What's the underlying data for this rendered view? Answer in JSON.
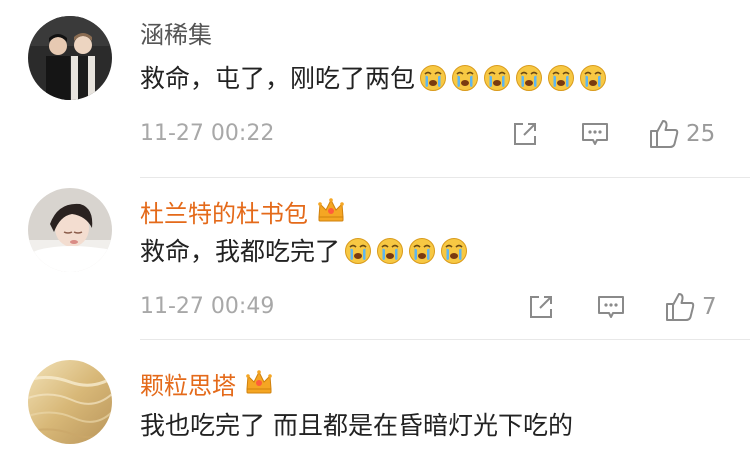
{
  "comments": [
    {
      "username": "涵稀集",
      "text": "救命，屯了，刚吃了两包",
      "emoji_name": "crying-emoji",
      "emoji_count": 6,
      "timestamp": "11-27 00:22",
      "likes": "25",
      "vip": false
    },
    {
      "username": "杜兰特的杜书包",
      "text": "救命，我都吃完了",
      "emoji_name": "crying-emoji",
      "emoji_count": 4,
      "timestamp": "11-27 00:49",
      "likes": "7",
      "vip": true
    },
    {
      "username": "颗粒思塔",
      "text": "我也吃完了 而且都是在昏暗灯光下吃的",
      "vip": true
    }
  ],
  "colors": {
    "username_default": "#555555",
    "username_vip": "#e46a1a",
    "meta_gray": "#a8a8a8",
    "crown_gold": "#f5a623"
  },
  "icons": {
    "share": "share-icon",
    "comment": "comment-icon",
    "like": "thumbs-up-icon",
    "vip": "crown-icon"
  }
}
